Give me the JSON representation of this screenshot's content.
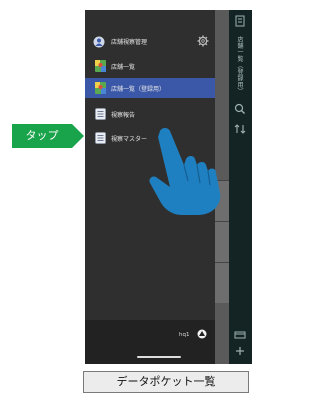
{
  "header": {
    "title": "店舗視察管理",
    "icon": "store-logo-icon",
    "settings_icon": "gear-icon"
  },
  "menu": {
    "items": [
      {
        "label": "店舗一覧",
        "icon": "map-icon",
        "selected": false
      },
      {
        "label": "店舗一覧（登録用）",
        "icon": "map-icon",
        "selected": true
      },
      {
        "label": "視察報告",
        "icon": "list-icon",
        "selected": false
      },
      {
        "label": "視察マスター",
        "icon": "list-icon",
        "selected": false
      }
    ]
  },
  "footer": {
    "user_name": "hq1",
    "user_icon": "user-icon"
  },
  "right_bar": {
    "vertical_title": "店舗一覧（登録用）"
  },
  "annotation": {
    "tap_label": "タップ"
  },
  "caption": "データポケット一覧",
  "colors": {
    "menu_bg": "#2f2f2f",
    "selected": "#3a57a8",
    "tap_badge": "#19a34a",
    "hand": "#1e7fc1"
  }
}
